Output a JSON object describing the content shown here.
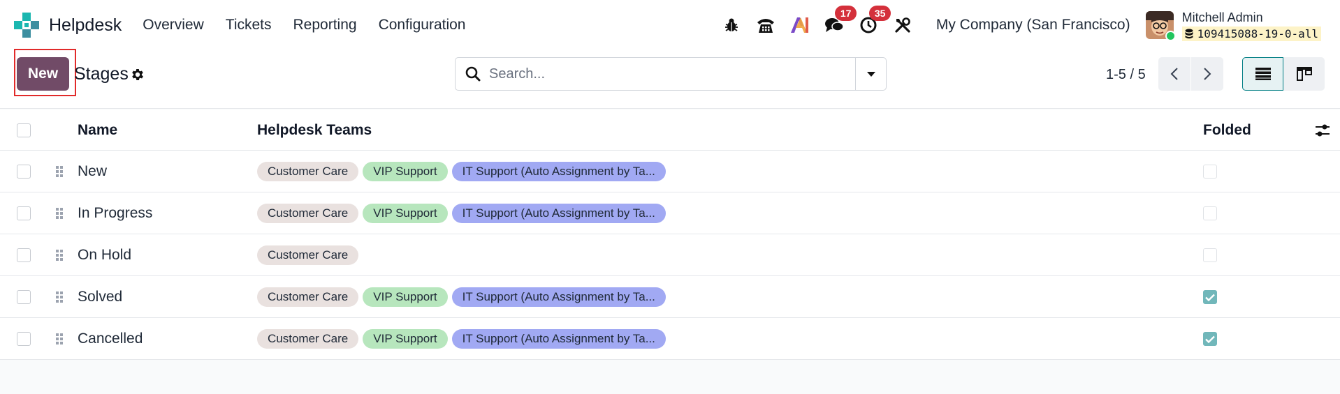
{
  "app": {
    "name": "Helpdesk",
    "menu": [
      "Overview",
      "Tickets",
      "Reporting",
      "Configuration"
    ]
  },
  "systray": {
    "messages_count": "17",
    "activities_count": "35",
    "company": "My Company (San Francisco)",
    "user_name": "Mitchell Admin",
    "database": "109415088-19-0-all"
  },
  "control_panel": {
    "new_label": "New",
    "breadcrumb": "Stages",
    "search_placeholder": "Search...",
    "pager": "1-5 / 5"
  },
  "table": {
    "columns": {
      "name": "Name",
      "teams": "Helpdesk Teams",
      "folded": "Folded"
    },
    "rows": [
      {
        "name": "New",
        "teams": [
          "Customer Care",
          "VIP Support",
          "IT Support (Auto Assignment by Ta..."
        ],
        "folded": false
      },
      {
        "name": "In Progress",
        "teams": [
          "Customer Care",
          "VIP Support",
          "IT Support (Auto Assignment by Ta..."
        ],
        "folded": false
      },
      {
        "name": "On Hold",
        "teams": [
          "Customer Care"
        ],
        "folded": false
      },
      {
        "name": "Solved",
        "teams": [
          "Customer Care",
          "VIP Support",
          "IT Support (Auto Assignment by Ta..."
        ],
        "folded": true
      },
      {
        "name": "Cancelled",
        "teams": [
          "Customer Care",
          "VIP Support",
          "IT Support (Auto Assignment by Ta..."
        ],
        "folded": true
      }
    ]
  },
  "colors": {
    "primary": "#714b67",
    "badge": "#d4303b",
    "tag_customer_care": "#e9e1df",
    "tag_vip_support": "#b7e6bd",
    "tag_it_support": "#a1a9f3",
    "folded_checked": "#71b7ba",
    "highlight": "#e12a2a"
  }
}
